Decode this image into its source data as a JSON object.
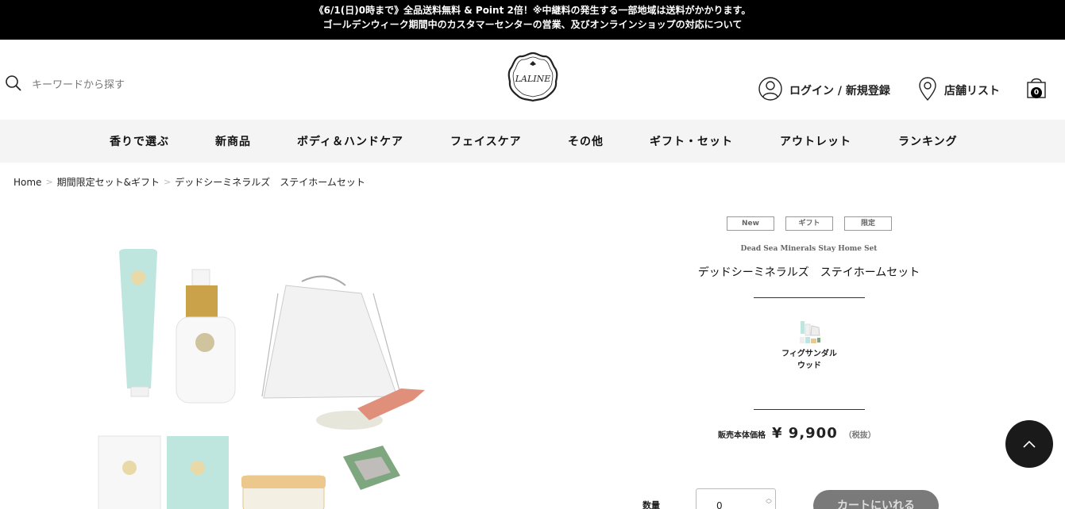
{
  "announcement": {
    "line1": "《6/1(日)0時まで》全品送料無料 & Point 2倍！※中継料の発生する一部地域は送料がかかります。",
    "line2": "ゴールデンウィーク期間中のカスタマーセンターの営業、及びオンラインショップの対応について"
  },
  "header": {
    "search_placeholder": "キーワードから探す",
    "logo_text": "LALINE",
    "login_label": "ログイン / 新規登録",
    "stores_label": "店舗リスト",
    "cart_count": "0"
  },
  "nav": {
    "items": [
      "香りで選ぶ",
      "新商品",
      "ボディ＆ハンドケア",
      "フェイスケア",
      "その他",
      "ギフト・セット",
      "アウトレット",
      "ランキング"
    ]
  },
  "breadcrumb": {
    "home": "Home",
    "category": "期間限定セット&ギフト",
    "current": "デッドシーミネラルズ　ステイホームセット",
    "separator": ">"
  },
  "product": {
    "tags": [
      "New",
      "ギフト",
      "限定"
    ],
    "name_en": "Dead Sea Minerals Stay Home Set",
    "name_jp": "デッドシーミネラルズ　ステイホームセット",
    "variant_name_line1": "フィグサンダル",
    "variant_name_line2": "ウッド",
    "price_label": "販売本体価格",
    "price": "¥ 9,900",
    "tax_note": "（税抜）",
    "quantity_label": "数量",
    "quantity_value": "0",
    "cart_button_label": "カートにいれる"
  },
  "colors": {
    "announce_bg": "#000000",
    "nav_bg": "#f4f4f4",
    "cart_button_bg": "#7a7a7a",
    "mint": "#bfe5df",
    "gold": "#c9a24a"
  }
}
